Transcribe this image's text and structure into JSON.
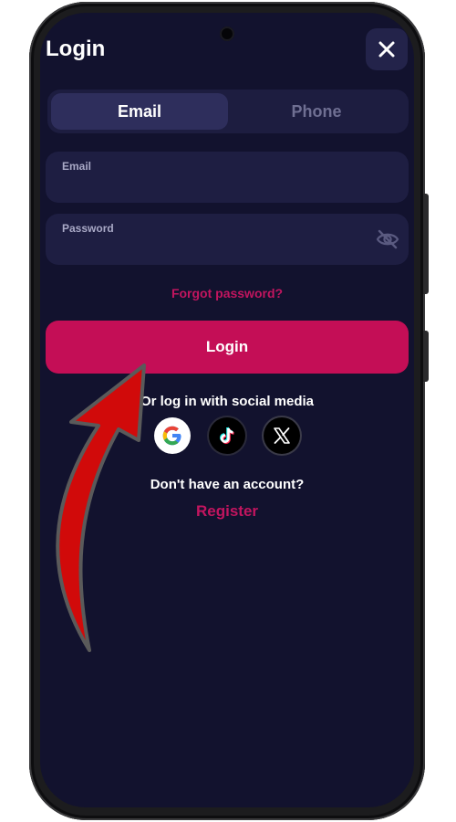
{
  "header": {
    "title": "Login",
    "close_icon": "close-icon"
  },
  "tabs": [
    {
      "label": "Email",
      "active": true
    },
    {
      "label": "Phone",
      "active": false
    }
  ],
  "form": {
    "email": {
      "label": "Email",
      "value": "",
      "placeholder": ""
    },
    "password": {
      "label": "Password",
      "value": "",
      "placeholder": "",
      "toggle_icon": "eye-slash-icon"
    },
    "forgot_label": "Forgot password?",
    "submit_label": "Login"
  },
  "social": {
    "title": "Or log in with social media",
    "providers": [
      {
        "name": "Google",
        "icon": "google-icon"
      },
      {
        "name": "TikTok",
        "icon": "tiktok-icon"
      },
      {
        "name": "X",
        "icon": "x-icon"
      }
    ]
  },
  "footer": {
    "prompt": "Don't have an account?",
    "register_label": "Register"
  },
  "colors": {
    "background": "#12122e",
    "surface": "#1e1e42",
    "accent": "#c40e56",
    "arrow": "#d10a0a"
  }
}
